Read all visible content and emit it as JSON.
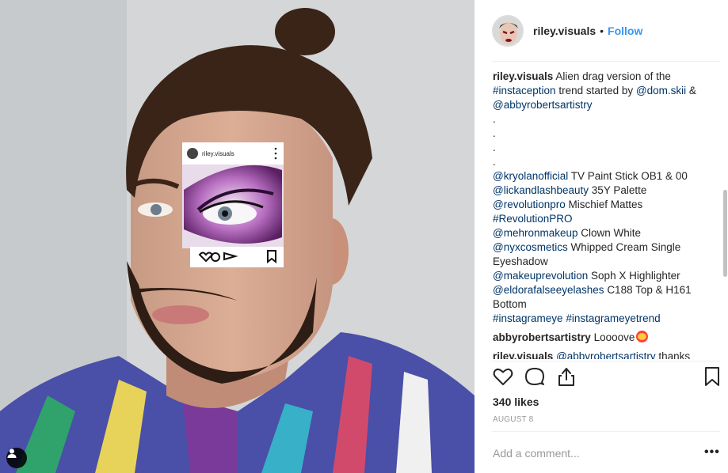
{
  "post": {
    "username": "riley.visuals",
    "follow_label": "Follow",
    "dot": "•",
    "inset_username": "riley.visuals"
  },
  "caption": {
    "user": "riley.visuals",
    "text_1": "Alien drag version of the",
    "hashtag_1": "#instaception",
    "text_2": "trend started by",
    "mention_1": "@dom.skii",
    "amp": "&",
    "mention_2": "@abbyrobertsartistry",
    "dots": ".",
    "products": [
      {
        "link": "@kryolanofficial",
        "text": "TV Paint Stick OB1 & 00"
      },
      {
        "link": "@lickandlashbeauty",
        "text": "35Y Palette"
      },
      {
        "link": "@revolutionpro",
        "text": "Mischief Mattes"
      },
      {
        "link": "#RevolutionPRO",
        "text": ""
      },
      {
        "link": "@mehronmakeup",
        "text": "Clown White"
      },
      {
        "link": "@nyxcosmetics",
        "text": "Whipped Cream Single"
      },
      {
        "link": "",
        "text": "Eyeshadow"
      },
      {
        "link": "@makeuprevolution",
        "text": "Soph X Highlighter"
      },
      {
        "link": "@eldorafalseeyelashes",
        "text": "C188 Top & H161"
      },
      {
        "link": "",
        "text": "Bottom"
      }
    ],
    "hashtags_end_1": "#instagrameye",
    "hashtags_end_2": "#instagrameyetrend"
  },
  "comments": [
    {
      "user": "abbyrobertsartistry",
      "text": "Loooove"
    },
    {
      "user": "riley.visuals",
      "link": "@abbyrobertsartistry",
      "text": "thanks"
    }
  ],
  "likes_text": "340 likes",
  "date_text": "August 8",
  "comment_placeholder": "Add a comment...",
  "more_label": "•••",
  "icons": [
    "heart-icon",
    "comment-icon",
    "share-icon",
    "bookmark-icon",
    "user-tag-icon"
  ],
  "colors": {
    "follow": "#3897f0",
    "link": "#003569",
    "text": "#262626",
    "muted": "#999999"
  }
}
